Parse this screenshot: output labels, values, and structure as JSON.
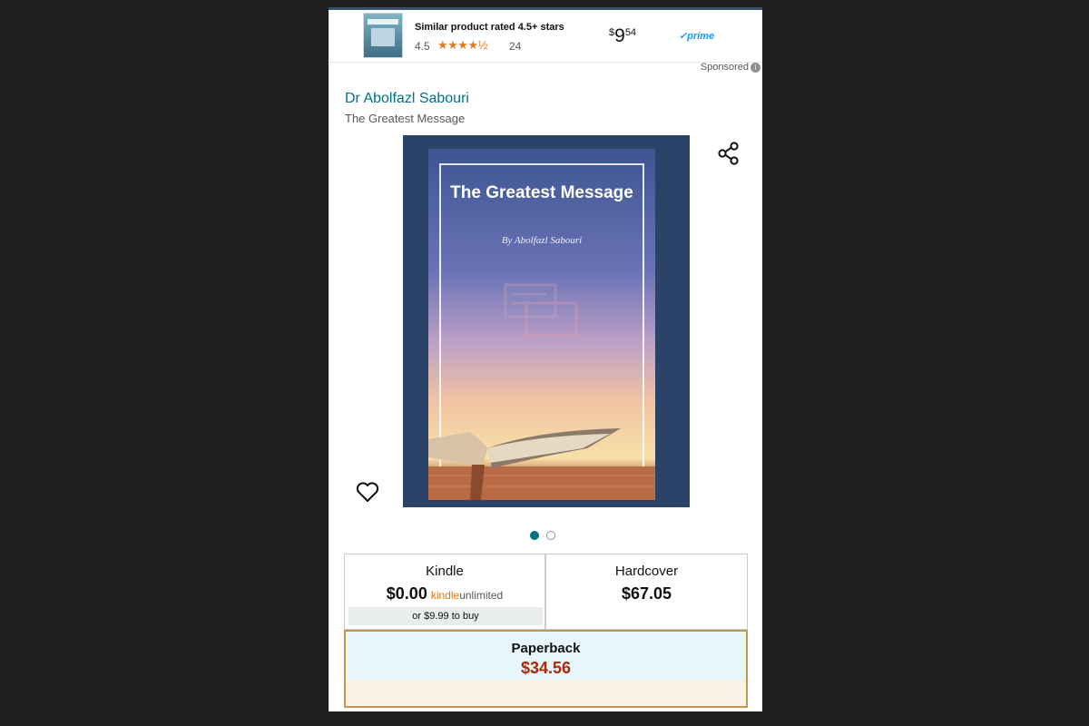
{
  "ad": {
    "title": "Similar product rated 4.5+ stars",
    "rating": "4.5",
    "stars": "★★★★½",
    "review_count": "24",
    "price_currency": "$",
    "price_whole": "9",
    "price_fraction": "54",
    "prime_label": "✓prime"
  },
  "sponsored_label": "Sponsored",
  "author": "Dr Abolfazl Sabouri",
  "book_title": "The Greatest Message",
  "cover": {
    "title": "The Greatest Message",
    "byline": "By Abolfazl Sabouri"
  },
  "carousel": {
    "total": 2,
    "active": 1
  },
  "formats": {
    "kindle": {
      "name": "Kindle",
      "price": "$0.00",
      "ku_brand": "kindle",
      "ku_suffix": "unlimited",
      "buy_text": "or $9.99 to buy"
    },
    "hardcover": {
      "name": "Hardcover",
      "price": "$67.05"
    },
    "paperback": {
      "name": "Paperback",
      "price": "$34.56"
    }
  },
  "colors": {
    "link": "#007185",
    "price_red": "#b12704",
    "star_orange": "#de7921",
    "selected_border": "#c7954a"
  }
}
